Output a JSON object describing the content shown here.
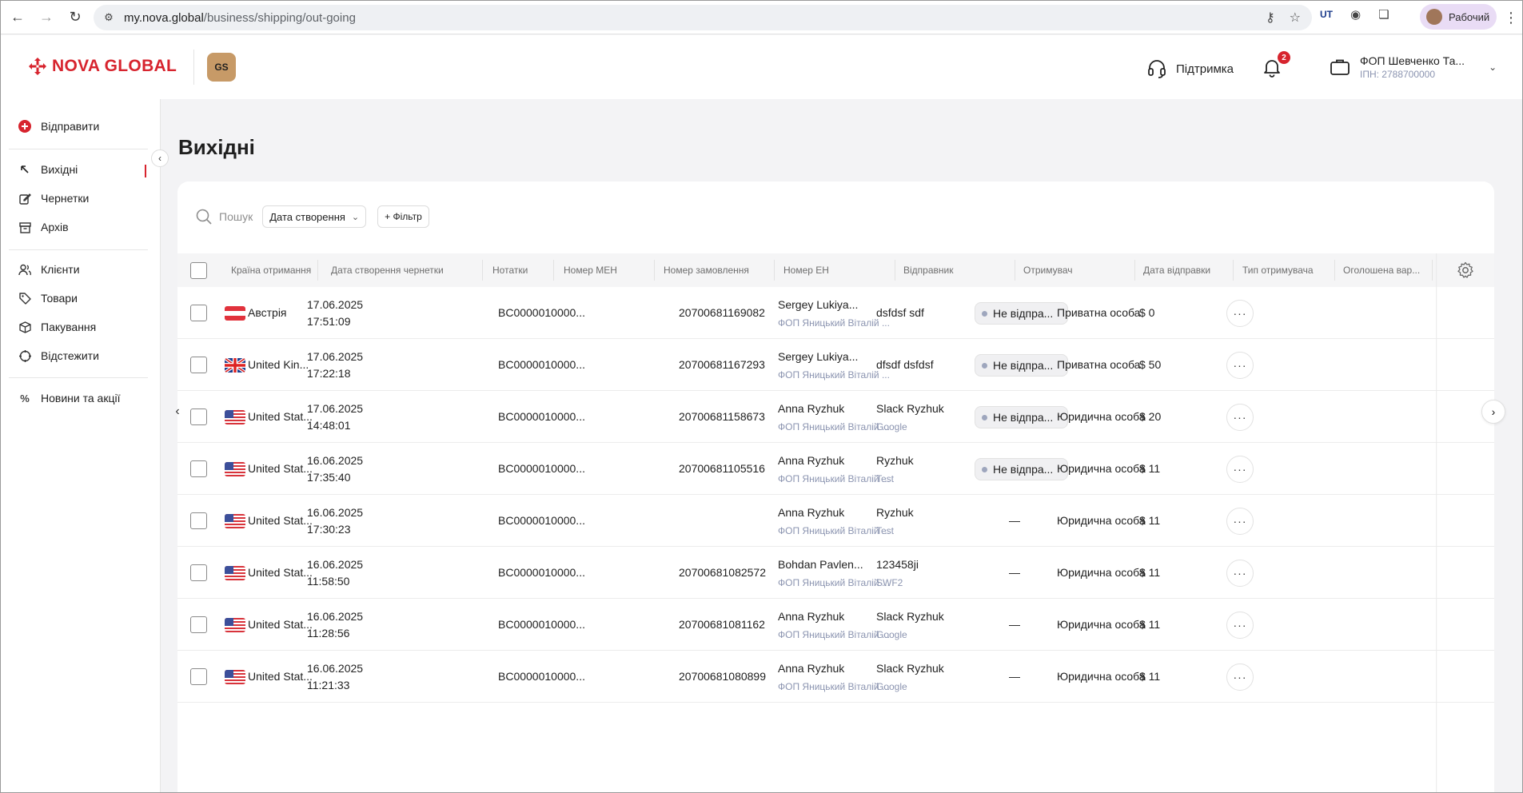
{
  "browser": {
    "url_host": "my.nova.global",
    "url_path": "/business/shipping/out-going",
    "profile_label": "Рабочий"
  },
  "header": {
    "logo_text": "NOVA GLOBAL",
    "badge_text": "GS",
    "support_label": "Підтримка",
    "notifications_count": "2",
    "account_name": "ФОП Шевченко Та...",
    "account_inn": "ІПН: 2788700000"
  },
  "sidebar": {
    "send_label": "Відправити",
    "items": [
      {
        "label": "Вихідні"
      },
      {
        "label": "Чернетки"
      },
      {
        "label": "Архів"
      },
      {
        "label": "Клієнти"
      },
      {
        "label": "Товари"
      },
      {
        "label": "Пакування"
      },
      {
        "label": "Відстежити"
      },
      {
        "label": "Новини та акції"
      }
    ]
  },
  "page": {
    "title": "Вихідні",
    "search_placeholder": "Пошук",
    "date_filter_label": "Дата створення",
    "add_filter_label": "+ Фільтр"
  },
  "columns": [
    "Країна отримання",
    "Дата створення чернетки",
    "Нотатки",
    "Номер MEH",
    "Номер замовлення",
    "Номер ЕН",
    "Відправник",
    "Отримувач",
    "Дата відправки",
    "Тип отримувача",
    "Оголошена вар..."
  ],
  "rows": [
    {
      "country": "Австрія",
      "flag": "at",
      "date": "17.06.2025",
      "time": "17:51:09",
      "meh": "BC0000010000...",
      "en": "20700681169082",
      "sender": "Sergey Lukiya...",
      "sender_company": "ФОП Яницький Віталій ...",
      "recipient": "dsfdsf sdf",
      "recipient_company": "",
      "status": "Не відпра...",
      "recipient_type": "Приватна особа",
      "declared": "$ 0"
    },
    {
      "country": "United Kin...",
      "flag": "gb",
      "date": "17.06.2025",
      "time": "17:22:18",
      "meh": "BC0000010000...",
      "en": "20700681167293",
      "sender": "Sergey Lukiya...",
      "sender_company": "ФОП Яницький Віталій ...",
      "recipient": "dfsdf dsfdsf",
      "recipient_company": "",
      "status": "Не відпра...",
      "recipient_type": "Приватна особа",
      "declared": "$ 50"
    },
    {
      "country": "United Stat...",
      "flag": "us",
      "date": "17.06.2025",
      "time": "14:48:01",
      "meh": "BC0000010000...",
      "en": "20700681158673",
      "sender": "Anna Ryzhuk",
      "sender_company": "ФОП Яницький Віталій ...",
      "recipient": "Slack Ryzhuk",
      "recipient_company": "Google",
      "status": "Не відпра...",
      "recipient_type": "Юридична особа",
      "declared": "$ 20"
    },
    {
      "country": "United Stat...",
      "flag": "us",
      "date": "16.06.2025",
      "time": "17:35:40",
      "meh": "BC0000010000...",
      "en": "20700681105516",
      "sender": "Anna Ryzhuk",
      "sender_company": "ФОП Яницький Віталій ...",
      "recipient": "Ryzhuk",
      "recipient_company": "Test",
      "status": "Не відпра...",
      "recipient_type": "Юридична особа",
      "declared": "$ 11"
    },
    {
      "country": "United Stat...",
      "flag": "us",
      "date": "16.06.2025",
      "time": "17:30:23",
      "meh": "BC0000010000...",
      "en": "",
      "sender": "Anna Ryzhuk",
      "sender_company": "ФОП Яницький Віталій ...",
      "recipient": "Ryzhuk",
      "recipient_company": "Test",
      "status": "",
      "recipient_type": "Юридична особа",
      "declared": "$ 11"
    },
    {
      "country": "United Stat...",
      "flag": "us",
      "date": "16.06.2025",
      "time": "11:58:50",
      "meh": "BC0000010000...",
      "en": "20700681082572",
      "sender": "Bohdan Pavlen...",
      "sender_company": "ФОП Яницький Віталій ...",
      "recipient": "123458ji",
      "recipient_company": "SWF2",
      "status": "",
      "recipient_type": "Юридична особа",
      "declared": "$ 11"
    },
    {
      "country": "United Stat...",
      "flag": "us",
      "date": "16.06.2025",
      "time": "11:28:56",
      "meh": "BC0000010000...",
      "en": "20700681081162",
      "sender": "Anna Ryzhuk",
      "sender_company": "ФОП Яницький Віталій ...",
      "recipient": "Slack Ryzhuk",
      "recipient_company": "Google",
      "status": "",
      "recipient_type": "Юридична особа",
      "declared": "$ 11"
    },
    {
      "country": "United Stat...",
      "flag": "us",
      "date": "16.06.2025",
      "time": "11:21:33",
      "meh": "BC0000010000...",
      "en": "20700681080899",
      "sender": "Anna Ryzhuk",
      "sender_company": "ФОП Яницький Віталій ...",
      "recipient": "Slack Ryzhuk",
      "recipient_company": "Google",
      "status": "",
      "recipient_type": "Юридична особа",
      "declared": "$ 11"
    }
  ],
  "empty_status": "—",
  "colors": {
    "brand": "#d7242e",
    "muted": "#8b94b0"
  }
}
